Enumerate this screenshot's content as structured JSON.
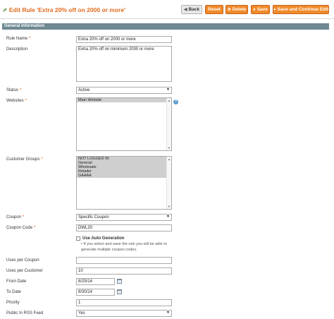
{
  "header": {
    "title": "Edit Rule 'Extra 20% off on 2000 or more'",
    "buttons": {
      "back": "Back",
      "reset": "Reset",
      "delete": "Delete",
      "save": "Save",
      "save_continue": "Save and Continue Edit"
    }
  },
  "section": {
    "title": "General Information"
  },
  "form": {
    "rule_name": {
      "label": "Rule Name",
      "value": "Extra 20% off on 2000 or more"
    },
    "description": {
      "label": "Description",
      "value": "Extra 20% off on minimum 2000 or more"
    },
    "status": {
      "label": "Status",
      "value": "Active"
    },
    "websites": {
      "label": "Websites",
      "options": [
        "Main Website"
      ]
    },
    "customer_groups": {
      "label": "Customer Groups",
      "options": [
        "NOT LOGGED IN",
        "General",
        "Wholesale",
        "Retailer",
        "GAAAA"
      ]
    },
    "coupon": {
      "label": "Coupon",
      "value": "Specific Coupon"
    },
    "coupon_code": {
      "label": "Coupon Code",
      "value": "DWL20"
    },
    "auto_generation": {
      "label": "Use Auto Generation",
      "note_line1": "If you select and save the rule you will be able to",
      "note_line2": "generate multiple coupon codes."
    },
    "uses_per_coupon": {
      "label": "Uses per Coupon",
      "value": ""
    },
    "uses_per_customer": {
      "label": "Uses per Customer",
      "value": "10"
    },
    "from_date": {
      "label": "From Date",
      "value": "8/25/14"
    },
    "to_date": {
      "label": "To Date",
      "value": "8/30/14"
    },
    "priority": {
      "label": "Priority",
      "value": "1"
    },
    "public_rss": {
      "label": "Public In RSS Feed",
      "value": "Yes"
    }
  },
  "required_marker": "*",
  "colors": {
    "accent": "#e36a1d",
    "button": "#f08a2a",
    "section_header": "#6f8992"
  }
}
